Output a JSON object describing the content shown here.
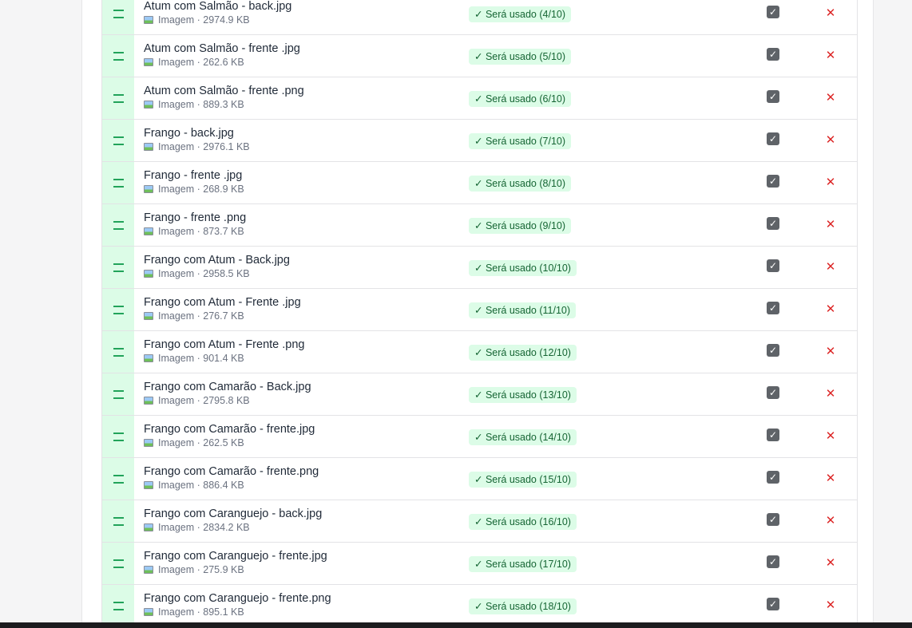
{
  "colors": {
    "handle_bg": "#dcfce7",
    "badge_bg": "#dcfce7",
    "badge_text": "#166534",
    "remove": "#dc2626",
    "checkbox": "#5f6368"
  },
  "icons": {
    "drag": "drag-handle-icon",
    "file": "image-file-icon",
    "check": "checkmark-icon",
    "remove": "close-x-icon"
  },
  "files": [
    {
      "name": "Atum com Salmão - back.jpg",
      "meta": "Imagem · 2974.9 KB",
      "status": "✓ Será usado (4/10)"
    },
    {
      "name": "Atum com Salmão - frente .jpg",
      "meta": "Imagem · 262.6 KB",
      "status": "✓ Será usado (5/10)"
    },
    {
      "name": "Atum com Salmão - frente .png",
      "meta": "Imagem · 889.3 KB",
      "status": "✓ Será usado (6/10)"
    },
    {
      "name": "Frango - back.jpg",
      "meta": "Imagem · 2976.1 KB",
      "status": "✓ Será usado (7/10)"
    },
    {
      "name": "Frango - frente .jpg",
      "meta": "Imagem · 268.9 KB",
      "status": "✓ Será usado (8/10)"
    },
    {
      "name": "Frango - frente .png",
      "meta": "Imagem · 873.7 KB",
      "status": "✓ Será usado (9/10)"
    },
    {
      "name": "Frango com Atum - Back.jpg",
      "meta": "Imagem · 2958.5 KB",
      "status": "✓ Será usado (10/10)"
    },
    {
      "name": "Frango com Atum - Frente .jpg",
      "meta": "Imagem · 276.7 KB",
      "status": "✓ Será usado (11/10)"
    },
    {
      "name": "Frango com Atum - Frente .png",
      "meta": "Imagem · 901.4 KB",
      "status": "✓ Será usado (12/10)"
    },
    {
      "name": "Frango com Camarão - Back.jpg",
      "meta": "Imagem · 2795.8 KB",
      "status": "✓ Será usado (13/10)"
    },
    {
      "name": "Frango com Camarão - frente.jpg",
      "meta": "Imagem · 262.5 KB",
      "status": "✓ Será usado (14/10)"
    },
    {
      "name": "Frango com Camarão - frente.png",
      "meta": "Imagem · 886.4 KB",
      "status": "✓ Será usado (15/10)"
    },
    {
      "name": "Frango com Caranguejo - back.jpg",
      "meta": "Imagem · 2834.2 KB",
      "status": "✓ Será usado (16/10)"
    },
    {
      "name": "Frango com Caranguejo - frente.jpg",
      "meta": "Imagem · 275.9 KB",
      "status": "✓ Será usado (17/10)"
    },
    {
      "name": "Frango com Caranguejo - frente.png",
      "meta": "Imagem · 895.1 KB",
      "status": "✓ Será usado (18/10)"
    }
  ]
}
